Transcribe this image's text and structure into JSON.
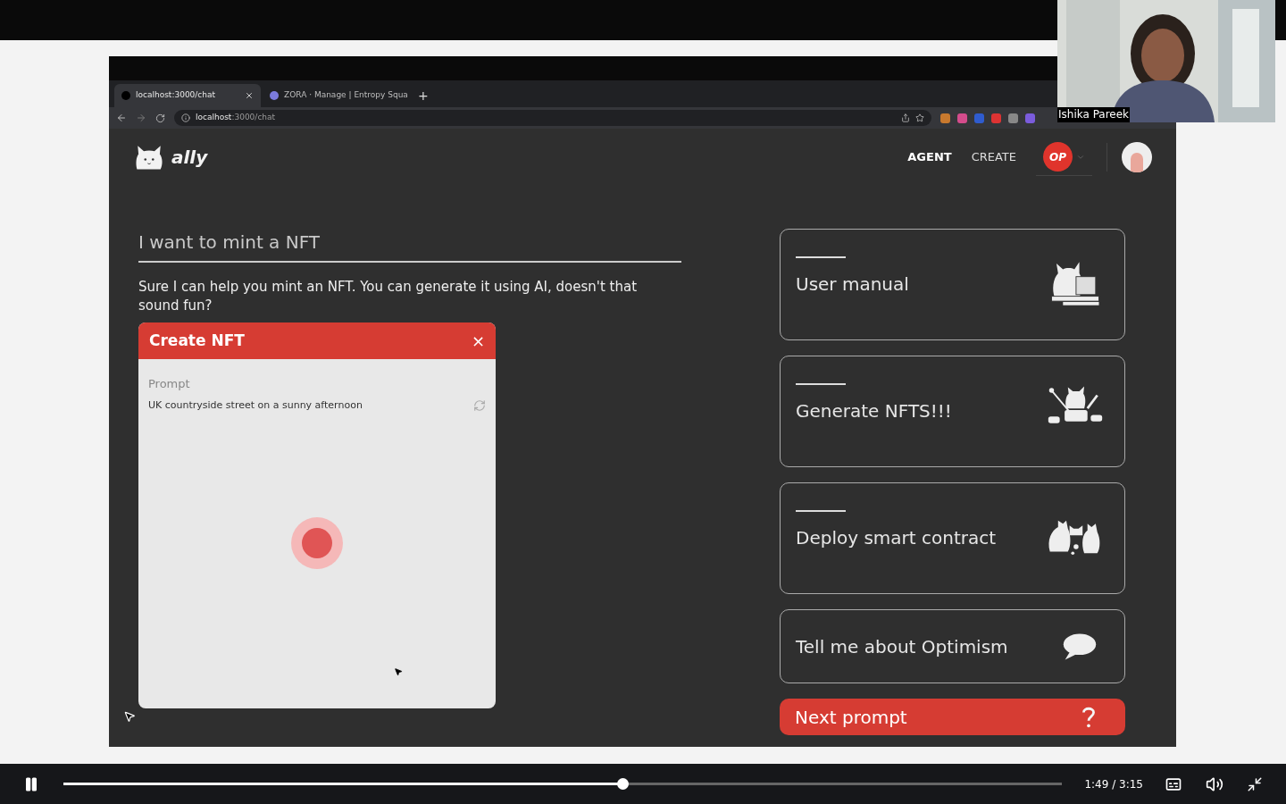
{
  "browser": {
    "tabs": [
      {
        "label": "localhost:3000/chat",
        "selected": true
      },
      {
        "label": "ZORA · Manage | Entropy Squa",
        "selected": false
      }
    ],
    "tab_new": "+",
    "url_host": "localhost",
    "url_path": ":3000/chat"
  },
  "app": {
    "logo": "ally",
    "nav": [
      {
        "label": "AGENT",
        "selected": true
      },
      {
        "label": "CREATE",
        "selected": false
      }
    ],
    "network_badge": "OP"
  },
  "chat": {
    "query": "I want to mint a NFT",
    "reply": "Sure I can help you mint an NFT. You can generate it using AI, doesn't that sound fun?",
    "dialog": {
      "title": "Create NFT",
      "close": "×",
      "prompt_label": "Prompt",
      "prompt_value": "UK countryside street on a sunny afternoon"
    }
  },
  "suggestions": [
    {
      "label": "User manual",
      "kind": "illustrated"
    },
    {
      "label": "Generate NFTS!!!",
      "kind": "illustrated"
    },
    {
      "label": "Deploy smart contract",
      "kind": "illustrated"
    },
    {
      "label": "Tell me about Optimism",
      "kind": "plain"
    },
    {
      "label": "Next prompt",
      "kind": "primary"
    }
  ],
  "webcam": {
    "name": "Ishika Pareek"
  },
  "player": {
    "playing": true,
    "level": 0.56,
    "time": "1:49 / 3:15"
  }
}
